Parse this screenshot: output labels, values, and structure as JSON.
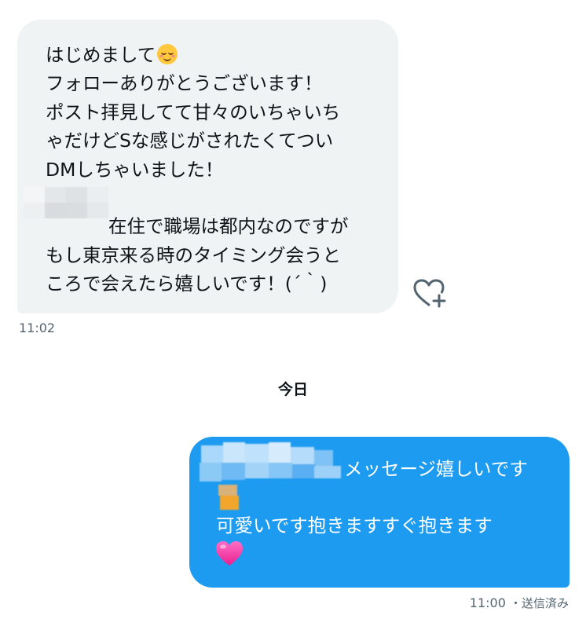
{
  "incoming_message": {
    "lines": [
      "はじめまして",
      "フォローありがとうございます！",
      "ポスト拝見してて甘々のいちゃいち",
      "ゃだけどSな感じがされたくてつい",
      "DMしちゃいました！",
      "",
      "在住で職場は都内なのですが",
      "もし東京来る時のタイミング会うと",
      "ころで会えたら嬉しいです！(´｀)"
    ],
    "line1_emoji": "relieved-face-emoji",
    "line7_redaction": "pixelated-redaction",
    "bubble_color": "#eff3f4",
    "text_color": "#0f1419",
    "timestamp": "11:02",
    "reaction_button_icon": "heart-plus-icon"
  },
  "date_separator": "今日",
  "outgoing_message": {
    "line1": "メッセージ嬉しいです",
    "line1_redaction": "pixelated-redaction",
    "line3": "可愛いです抱きますすぐ抱きます",
    "line4_emoji": "pink-heart-emoji",
    "bubble_color": "#1d9bf0",
    "text_color": "#ffffff",
    "timestamp": "11:00",
    "status": "・送信済み"
  },
  "meta_color": "#536471"
}
